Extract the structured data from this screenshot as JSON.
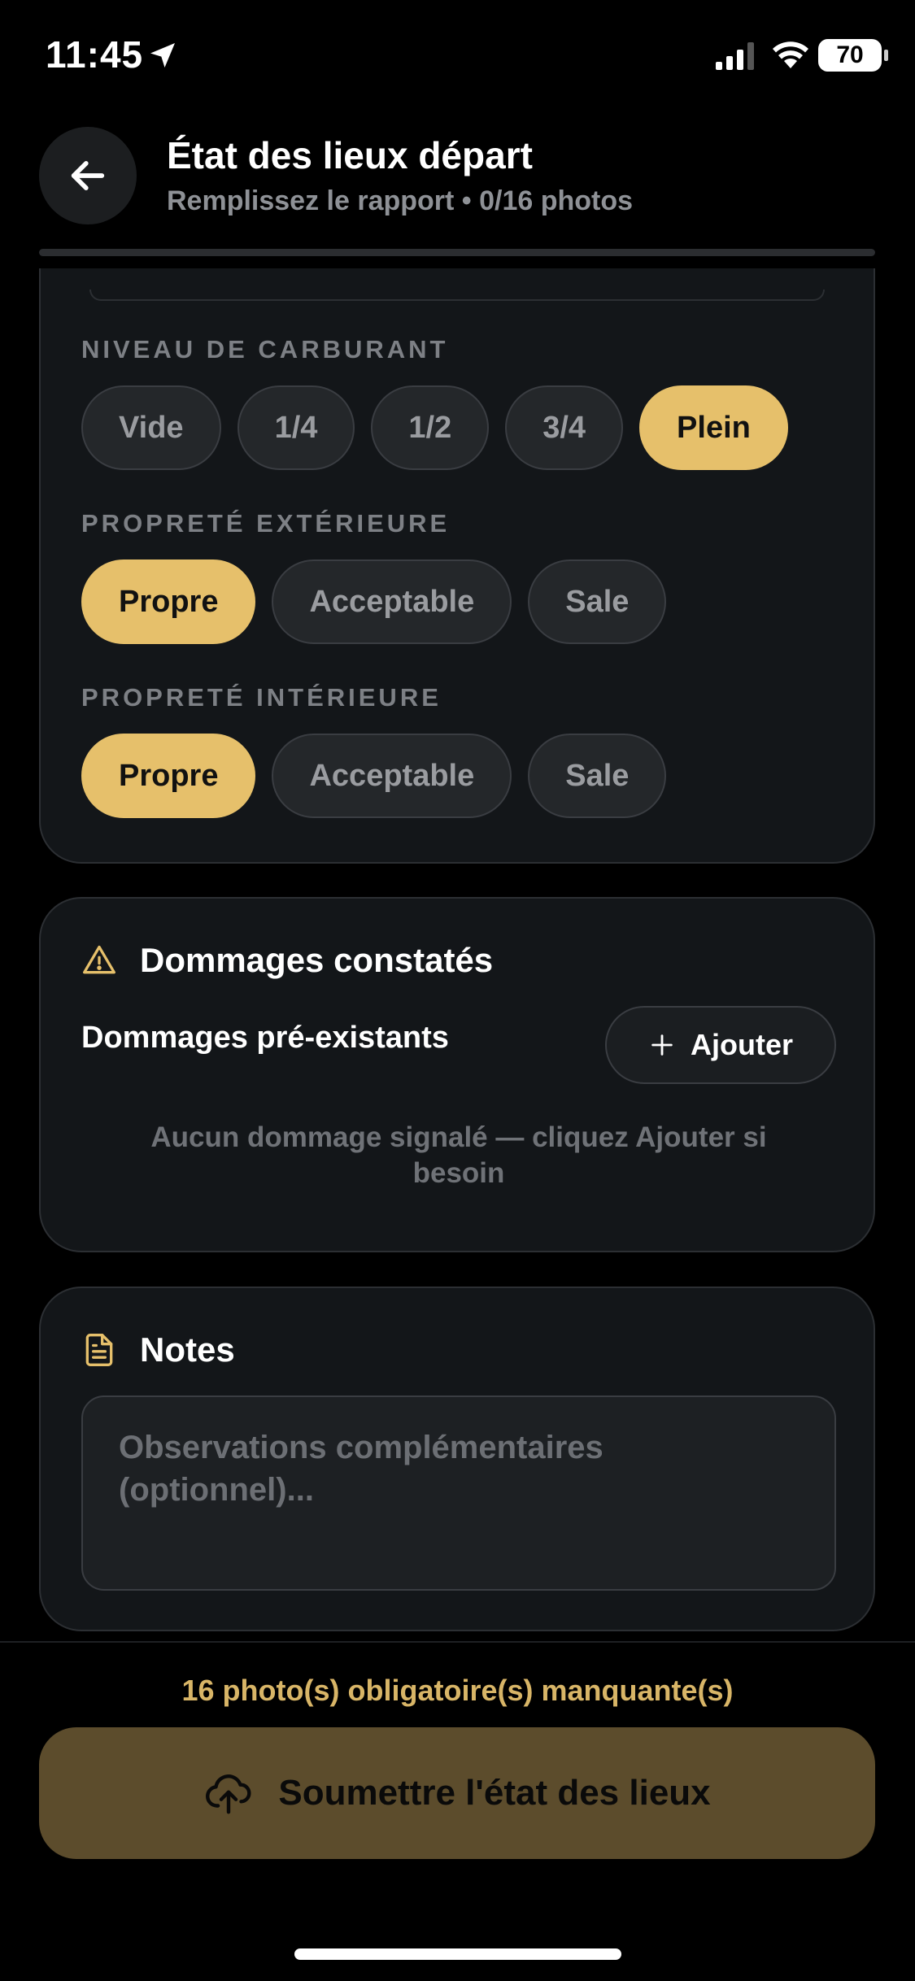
{
  "status_bar": {
    "time": "11:45",
    "battery": "70"
  },
  "header": {
    "title": "État des lieux départ",
    "subtitle": "Remplissez le rapport • 0/16 photos",
    "progress": 0
  },
  "vehicle_state": {
    "fuel": {
      "label": "NIVEAU DE CARBURANT",
      "options": [
        "Vide",
        "1/4",
        "1/2",
        "3/4",
        "Plein"
      ],
      "selected": "Plein"
    },
    "exterior": {
      "label": "PROPRETÉ EXTÉRIEURE",
      "options": [
        "Propre",
        "Acceptable",
        "Sale"
      ],
      "selected": "Propre"
    },
    "interior": {
      "label": "PROPRETÉ INTÉRIEURE",
      "options": [
        "Propre",
        "Acceptable",
        "Sale"
      ],
      "selected": "Propre"
    }
  },
  "damages": {
    "title": "Dommages constatés",
    "preexisting_label": "Dommages pré-existants",
    "add_label": "Ajouter",
    "empty_text": "Aucun dommage signalé — cliquez Ajouter si besoin"
  },
  "notes": {
    "title": "Notes",
    "placeholder": "Observations complémentaires (optionnel)..."
  },
  "footer": {
    "warning": "16 photo(s) obligatoire(s) manquante(s)",
    "submit_label": "Soumettre l'état des lieux"
  },
  "colors": {
    "accent": "#e6c06b",
    "submit_bg": "#5c4c2c",
    "card_bg": "#131619"
  },
  "icons": [
    "location-arrow-icon",
    "signal-icon",
    "wifi-icon",
    "battery-icon",
    "back-arrow-icon",
    "warning-triangle-icon",
    "plus-icon",
    "document-icon",
    "cloud-upload-icon"
  ]
}
